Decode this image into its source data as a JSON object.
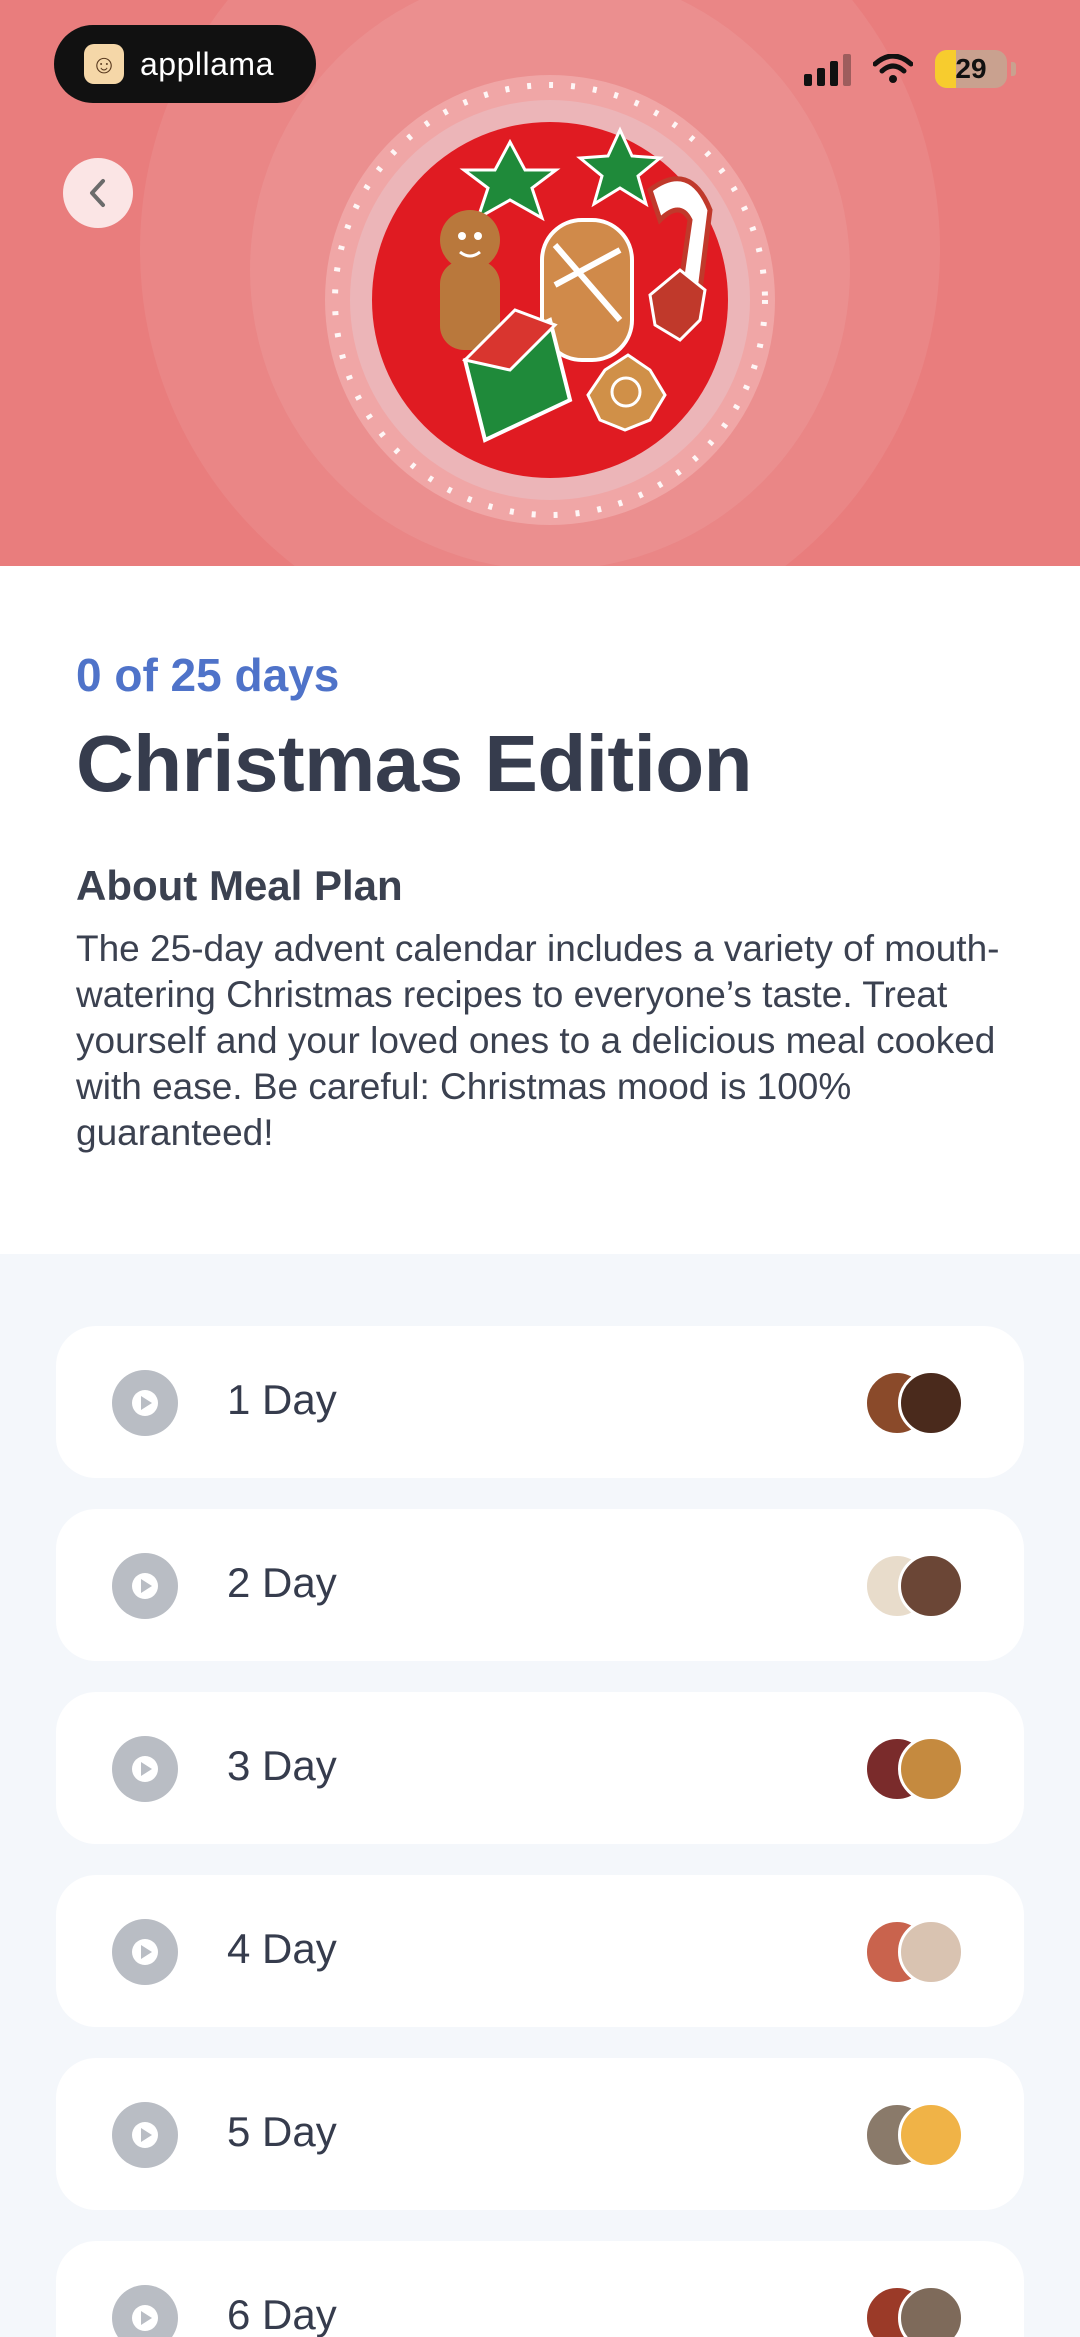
{
  "status_bar": {
    "app_badge": "appllama",
    "battery_level": "29"
  },
  "hero": {
    "back_icon": "chevron-left-icon",
    "image": "christmas-cookies-plate"
  },
  "plan": {
    "progress": "0 of 25 days",
    "title": "Christmas Edition",
    "about_heading": "About Meal Plan",
    "description": "The 25-day advent calendar includes a variety of mouth-watering Christmas recipes to everyone’s taste. Treat yourself and your loved ones to a delicious meal cooked with ease. Be careful: Christmas mood is 100% guaranteed!"
  },
  "days": [
    {
      "label": "1 Day",
      "thumb_a": "#8a4a2a",
      "thumb_b": "#4a2a1c"
    },
    {
      "label": "2 Day",
      "thumb_a": "#e8dccb",
      "thumb_b": "#6b4636"
    },
    {
      "label": "3 Day",
      "thumb_a": "#7a2b2b",
      "thumb_b": "#c58a3f"
    },
    {
      "label": "4 Day",
      "thumb_a": "#c9634d",
      "thumb_b": "#d9c3b1"
    },
    {
      "label": "5 Day",
      "thumb_a": "#8a7a6a",
      "thumb_b": "#f0b347"
    },
    {
      "label": "6 Day",
      "thumb_a": "#9b3a28",
      "thumb_b": "#7e6a5a"
    }
  ],
  "colors": {
    "hero_bg": "#e97d7d",
    "accent_blue": "#4f73c9",
    "title_text": "#363c4d",
    "list_bg": "#f4f7fb",
    "play_icon": "#b9bdc4"
  }
}
